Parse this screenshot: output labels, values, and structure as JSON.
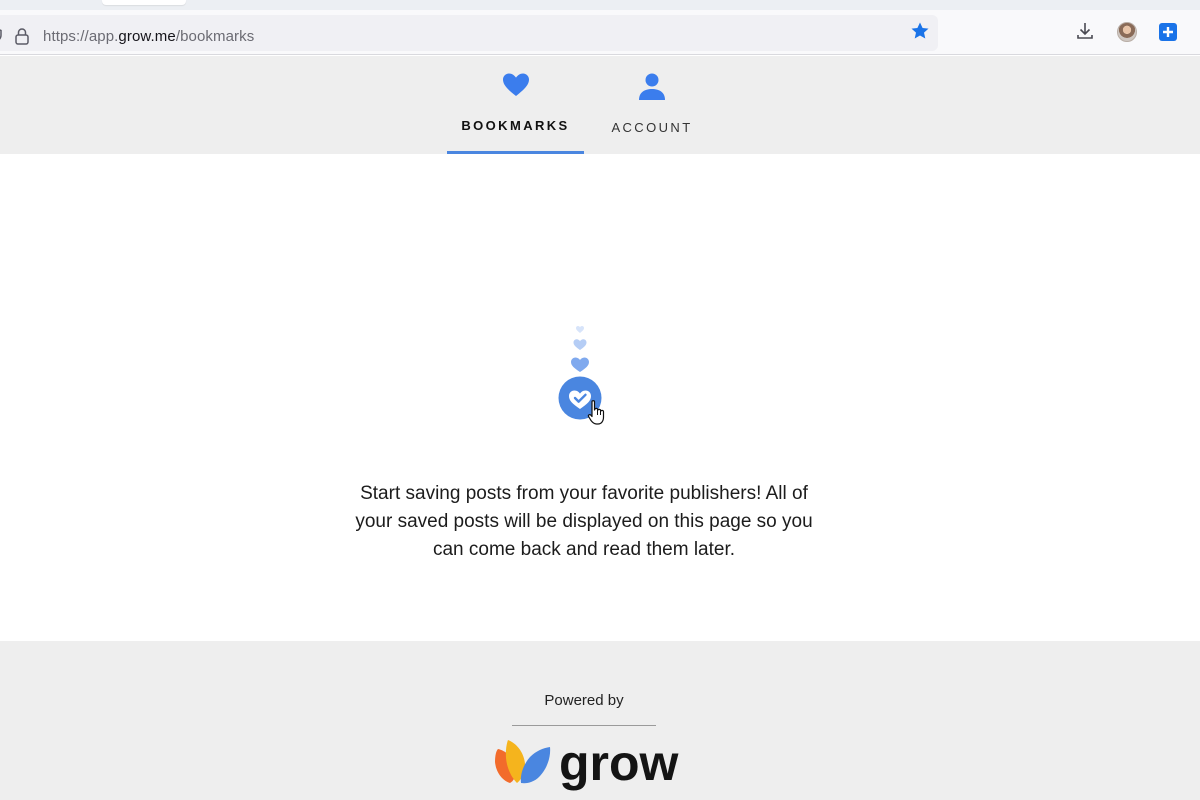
{
  "browser": {
    "url_prefix": "https://app.",
    "url_domain": "grow.me",
    "url_path": "/bookmarks",
    "star_color": "#1a73e8",
    "icons": [
      "shield-icon",
      "lock-icon",
      "star-icon",
      "download-icon",
      "avatar",
      "extension-icon"
    ]
  },
  "nav": {
    "tabs": [
      {
        "label": "BOOKMARKS",
        "icon": "heart-icon",
        "active": true
      },
      {
        "label": "ACCOUNT",
        "icon": "user-icon",
        "active": false
      }
    ],
    "accent_color": "#4a86e0",
    "icon_color": "#3b7ded"
  },
  "main": {
    "empty_message": "Start saving posts from your favorite publishers! All of your saved posts will be displayed on this page so you can come back and read them later.",
    "illustration": "hearts-with-cursor-icon"
  },
  "footer": {
    "powered_by": "Powered by",
    "brand_name": "grow",
    "brand_colors": [
      "#f26b2b",
      "#f5b41d",
      "#4a86e0"
    ]
  }
}
